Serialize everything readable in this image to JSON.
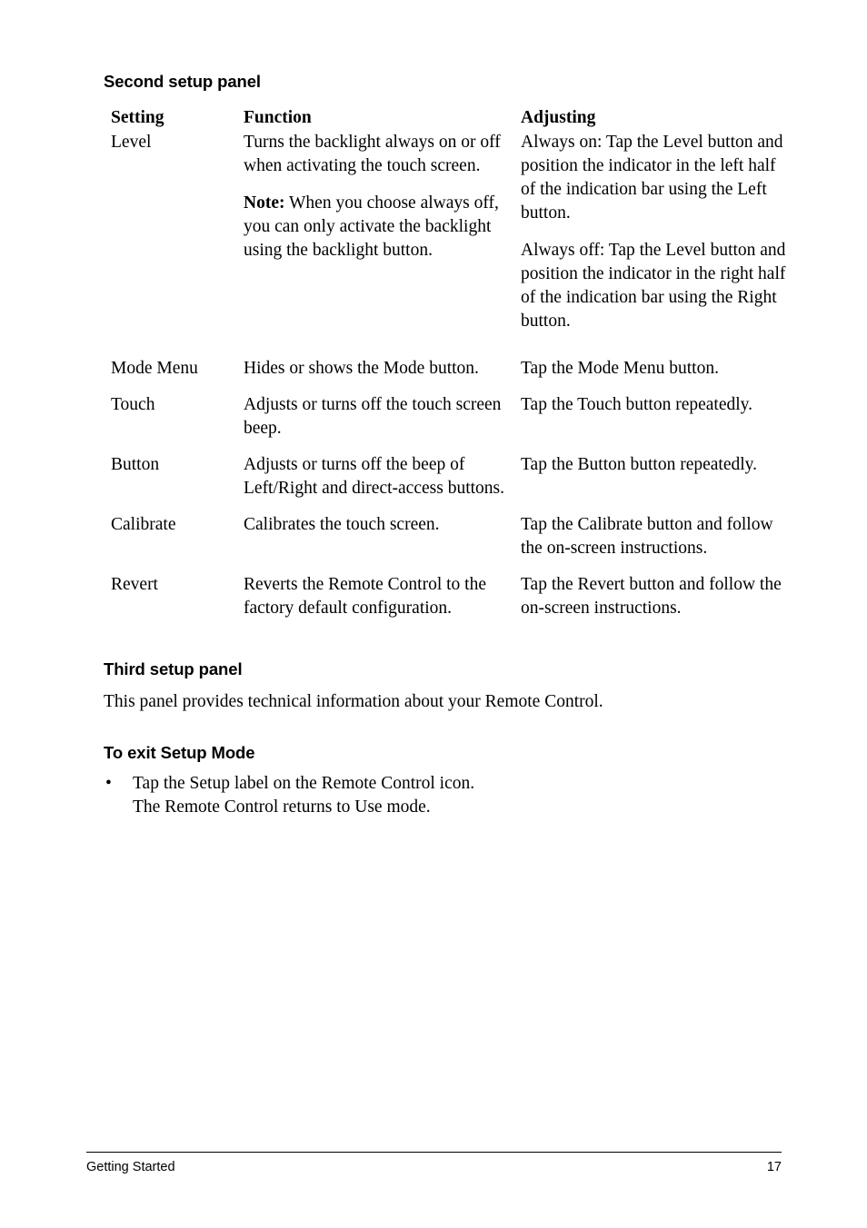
{
  "document": {
    "sections": {
      "second_panel_heading": "Second setup panel",
      "third_panel_heading": "Third setup panel",
      "third_panel_body": "This panel provides technical information about your Remote Control.",
      "exit_heading": "To exit Setup Mode"
    },
    "table": {
      "headers": {
        "setting": "Setting",
        "function": "Function",
        "adjusting": "Adjusting"
      },
      "rows": [
        {
          "setting": "Level",
          "function_p1": "Turns the backlight always on or off when activating the touch screen.",
          "function_p2_lead": "Note:",
          "function_p2": " When you choose always off, you can only activate the backlight using the backlight button.",
          "adjusting_p1": "Always on: Tap the Level button and position the indicator in the left half of the indication bar using the Left button.",
          "adjusting_p2": "Always off: Tap the Level button and position the indicator in the right half of the indication bar using the Right button."
        },
        {
          "setting": "Mode Menu",
          "function_p1": "Hides or shows the Mode button.",
          "adjusting_p1": "Tap the Mode Menu button."
        },
        {
          "setting": "Touch",
          "function_p1": "Adjusts or turns off the touch screen beep.",
          "adjusting_p1": "Tap the Touch button repeatedly."
        },
        {
          "setting": "Button",
          "function_p1": "Adjusts or turns off the beep of Left/Right and direct-access buttons.",
          "adjusting_p1": "Tap the Button button repeatedly."
        },
        {
          "setting": "Calibrate",
          "function_p1": "Calibrates the touch screen.",
          "adjusting_p1": "Tap the Calibrate button and follow the on-screen instructions."
        },
        {
          "setting": "Revert",
          "function_p1": "Reverts the Remote Control to the factory default configuration.",
          "adjusting_p1": "Tap the Revert button and follow the on-screen instructions."
        }
      ]
    },
    "bullets": [
      {
        "marker": "•",
        "line1": "Tap the Setup label on the Remote Control icon.",
        "line2": "The Remote Control returns to Use mode."
      }
    ],
    "footer": {
      "left": "Getting Started",
      "page_number": "17"
    }
  }
}
